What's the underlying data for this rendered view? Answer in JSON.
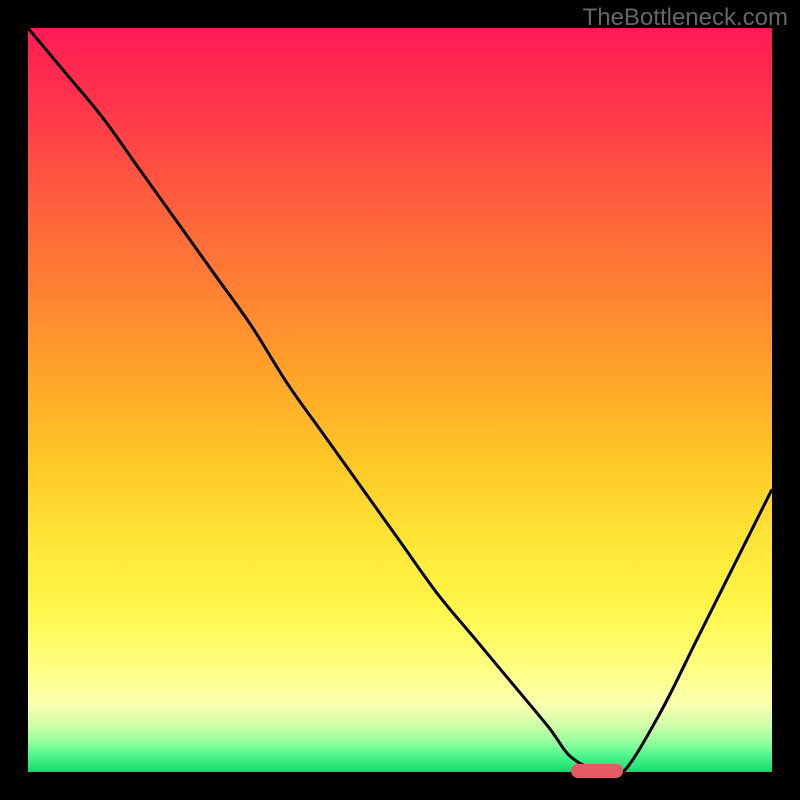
{
  "watermark": "TheBottleneck.com",
  "colors": {
    "background": "#000000",
    "curve": "#000000",
    "marker": "#e45a63",
    "gradient_top": "#ff1a54",
    "gradient_bottom": "#16d76b"
  },
  "chart_data": {
    "type": "line",
    "title": "",
    "xlabel": "",
    "ylabel": "",
    "xlim": [
      0,
      100
    ],
    "ylim": [
      0,
      100
    ],
    "x": [
      0,
      5,
      10,
      15,
      20,
      25,
      30,
      35,
      40,
      45,
      50,
      55,
      60,
      65,
      70,
      73,
      77,
      80,
      85,
      90,
      95,
      100
    ],
    "values": [
      100,
      94,
      88,
      81,
      74,
      67,
      60,
      52,
      45,
      38,
      31,
      24,
      18,
      12,
      6,
      2,
      0,
      0,
      8,
      18,
      28,
      38
    ],
    "minimum_range_x": [
      73,
      80
    ],
    "note": "Plot shows a V-shaped bottleneck curve over a vertical red→green gradient; minimum (green / ideal) occurs around x ≈ 73–80 where the red marker sits on the x-axis."
  }
}
